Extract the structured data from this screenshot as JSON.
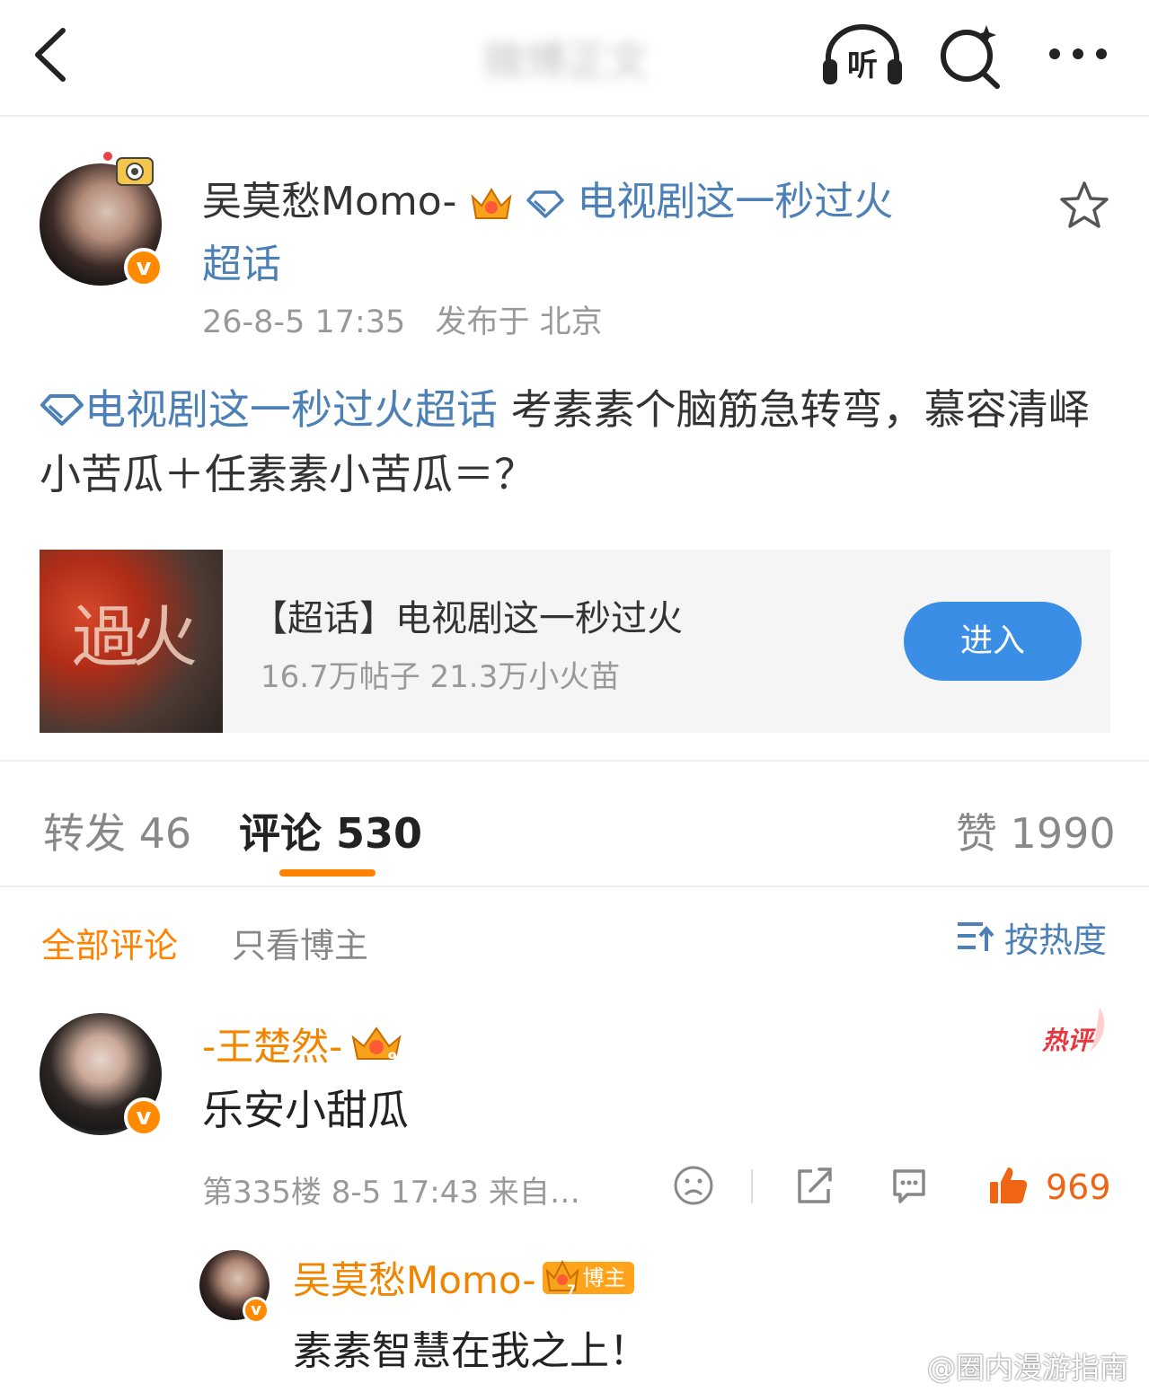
{
  "nav": {
    "title": "微博正文",
    "listen_label": "听"
  },
  "post": {
    "author": "吴莫愁Momo-",
    "topic_tag": "电视剧这一秒过火超话",
    "timestamp": "26-8-5 17:35",
    "location": "发布于 北京",
    "body_topic": "电视剧这一秒过火超话",
    "body_text": " 考素素个脑筋急转弯，慕容清峄小苦瓜＋任素素小苦瓜＝？"
  },
  "topic_card": {
    "thumb_text": "過火",
    "name": "【超话】电视剧这一秒过火",
    "stats": "16.7万帖子 21.3万小火苗",
    "enter_label": "进入"
  },
  "tabs": {
    "repost": "转发 46",
    "comment": "评论 530",
    "like": "赞 1990"
  },
  "filters": {
    "all": "全部评论",
    "blogger_only": "只看博主",
    "sort": "按热度"
  },
  "comment": {
    "user": "-王楚然-",
    "vip_level": "9",
    "hot_label": "热评",
    "text": "乐安小甜瓜",
    "meta": "第335楼 8-5 17:43 来自…",
    "likes": "969"
  },
  "reply": {
    "user": "吴莫愁Momo-",
    "badge": "博主",
    "vip_level": "7",
    "text": "素素智慧在我之上！"
  },
  "watermark": "@圈内漫游指南",
  "colors": {
    "accent_orange": "#ff8200",
    "link_blue": "#4d80b6",
    "button_blue": "#3a8ee6",
    "like_orange": "#f06514"
  },
  "icons": [
    "back-icon",
    "listen-headphones-icon",
    "search-sparkle-icon",
    "more-icon",
    "star-icon",
    "diamond-icon",
    "crown-icon",
    "verified-v-icon",
    "sort-icon",
    "sad-face-icon",
    "share-icon",
    "comment-icon",
    "thumbs-up-icon",
    "weibo-logo-icon"
  ]
}
